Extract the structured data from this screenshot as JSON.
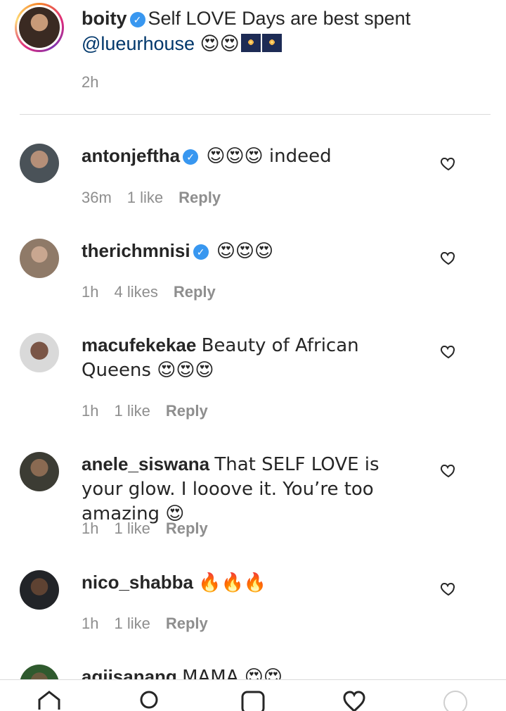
{
  "post": {
    "username": "boity",
    "caption": "Self LOVE Days are best spent",
    "mention": "@lueurhouse",
    "caption_emojis": "😍😍",
    "time": "2h"
  },
  "comments": [
    {
      "username": "antonjeftha",
      "verified": true,
      "text": "😍😍😍 indeed",
      "time": "36m",
      "likes": "1 like",
      "reply": "Reply"
    },
    {
      "username": "therichmnisi",
      "verified": true,
      "text": "😍😍😍",
      "time": "1h",
      "likes": "4 likes",
      "reply": "Reply"
    },
    {
      "username": "macufekekae",
      "verified": false,
      "text": "Beauty of African Queens 😍😍😍",
      "time": "1h",
      "likes": "1 like",
      "reply": "Reply"
    },
    {
      "username": "anele_siswana",
      "verified": false,
      "text": "That SELF LOVE is your glow. I looove it. You’re too amazing 😍",
      "time": "1h",
      "likes": "1 like",
      "reply": "Reply"
    },
    {
      "username": "nico_shabba",
      "verified": false,
      "text": "🔥🔥🔥",
      "time": "1h",
      "likes": "1 like",
      "reply": "Reply"
    },
    {
      "username": "agiisanang",
      "verified": false,
      "text": "MAMA 😍😍",
      "time": "",
      "likes": "",
      "reply": ""
    }
  ],
  "icons": {
    "verified": "verified-badge-icon",
    "like": "heart-outline-icon"
  },
  "colors": {
    "verified_blue": "#3897f0",
    "meta_gray": "#8e8e8e",
    "text": "#262626",
    "mention": "#00376b"
  }
}
